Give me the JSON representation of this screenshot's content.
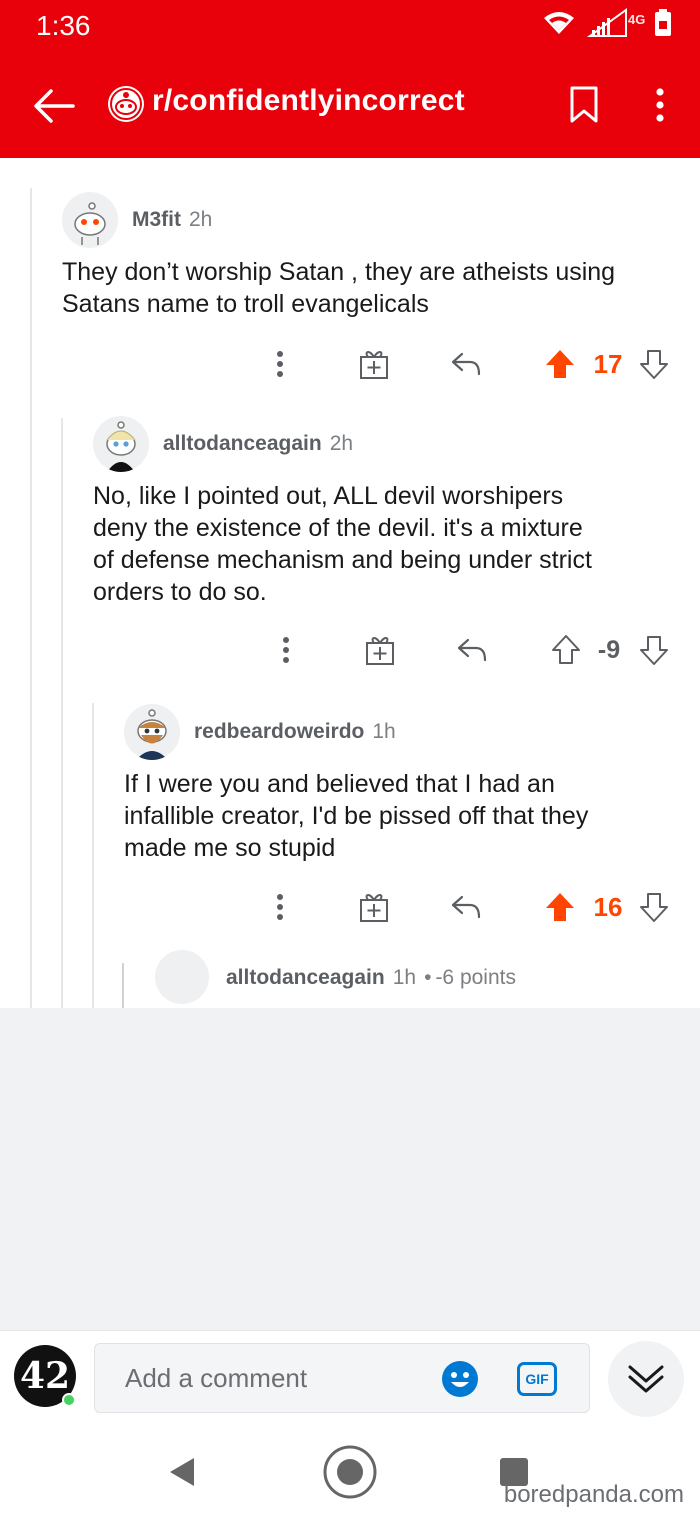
{
  "status_bar": {
    "time": "1:36",
    "network": "4G"
  },
  "header": {
    "subreddit": "r/confidentlyincorrect"
  },
  "comments": [
    {
      "author": "M3fit",
      "age": "2h",
      "body": [
        "They don’t worship Satan , they are atheists using",
        "Satans name to troll evangelicals"
      ],
      "score": "17",
      "voted": "up"
    },
    {
      "author": "alltodanceagain",
      "age": "2h",
      "body": [
        "No, like I pointed out, ALL devil worshipers",
        "deny the existence of the devil.  it's a mixture",
        "of defense mechanism and being under strict",
        "orders to do so."
      ],
      "score": "-9",
      "voted": "none"
    },
    {
      "author": "redbeardoweirdo",
      "age": "1h",
      "body": [
        "If I were you and believed that I had an",
        "infallible creator, I'd be pissed off that they",
        "made me so stupid"
      ],
      "score": "16",
      "voted": "up"
    }
  ],
  "collapsed_reply": {
    "author": "alltodanceagain",
    "age": "1h",
    "separator": "•",
    "points": "-6 points"
  },
  "composer": {
    "placeholder": "Add a comment",
    "gif_label": "GIF",
    "user_avatar_text": "42"
  },
  "watermark": "boredpanda.com",
  "colors": {
    "header_bg": "#e8000b",
    "upvote": "#ff4500",
    "accent_blue": "#0079d3",
    "online": "#46d160"
  }
}
